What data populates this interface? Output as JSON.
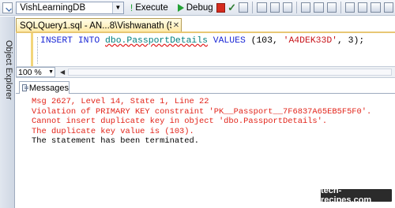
{
  "toolbar": {
    "database": "VishLearningDB",
    "execute_label": "Execute",
    "debug_label": "Debug"
  },
  "sidebar": {
    "object_explorer_label": "Object Explorer"
  },
  "editor": {
    "tab_title": "SQLQuery1.sql - AN...8\\Vishwanath (52))*",
    "code": {
      "kw_insert": "INSERT INTO",
      "table": "dbo.PassportDetails",
      "kw_values": "VALUES",
      "open": " (103, ",
      "str_value": "'A4DEK33D'",
      "close": ", 3);"
    },
    "zoom": "100 %"
  },
  "results": {
    "tab_label": "Messages",
    "error_lines": [
      "Msg 2627, Level 14, State 1, Line 22",
      "Violation of PRIMARY KEY constraint 'PK__Passport__7F6837A65EB5F5F0'.",
      "Cannot insert duplicate key in object 'dbo.PassportDetails'.",
      "The duplicate key value is (103)."
    ],
    "info_line": "The statement has been terminated."
  },
  "watermark": "tech-recipes.com",
  "colors": {
    "error_text": "#e2241a",
    "keyword": "#1b28d6",
    "string": "#c8151b",
    "table_name": "#008080",
    "tab_active": "#ffe9a6"
  },
  "icons": [
    "check-icon",
    "execute-icon",
    "debug-icon",
    "stop-icon",
    "messages-icon",
    "close-icon",
    "chevron-down-icon"
  ]
}
